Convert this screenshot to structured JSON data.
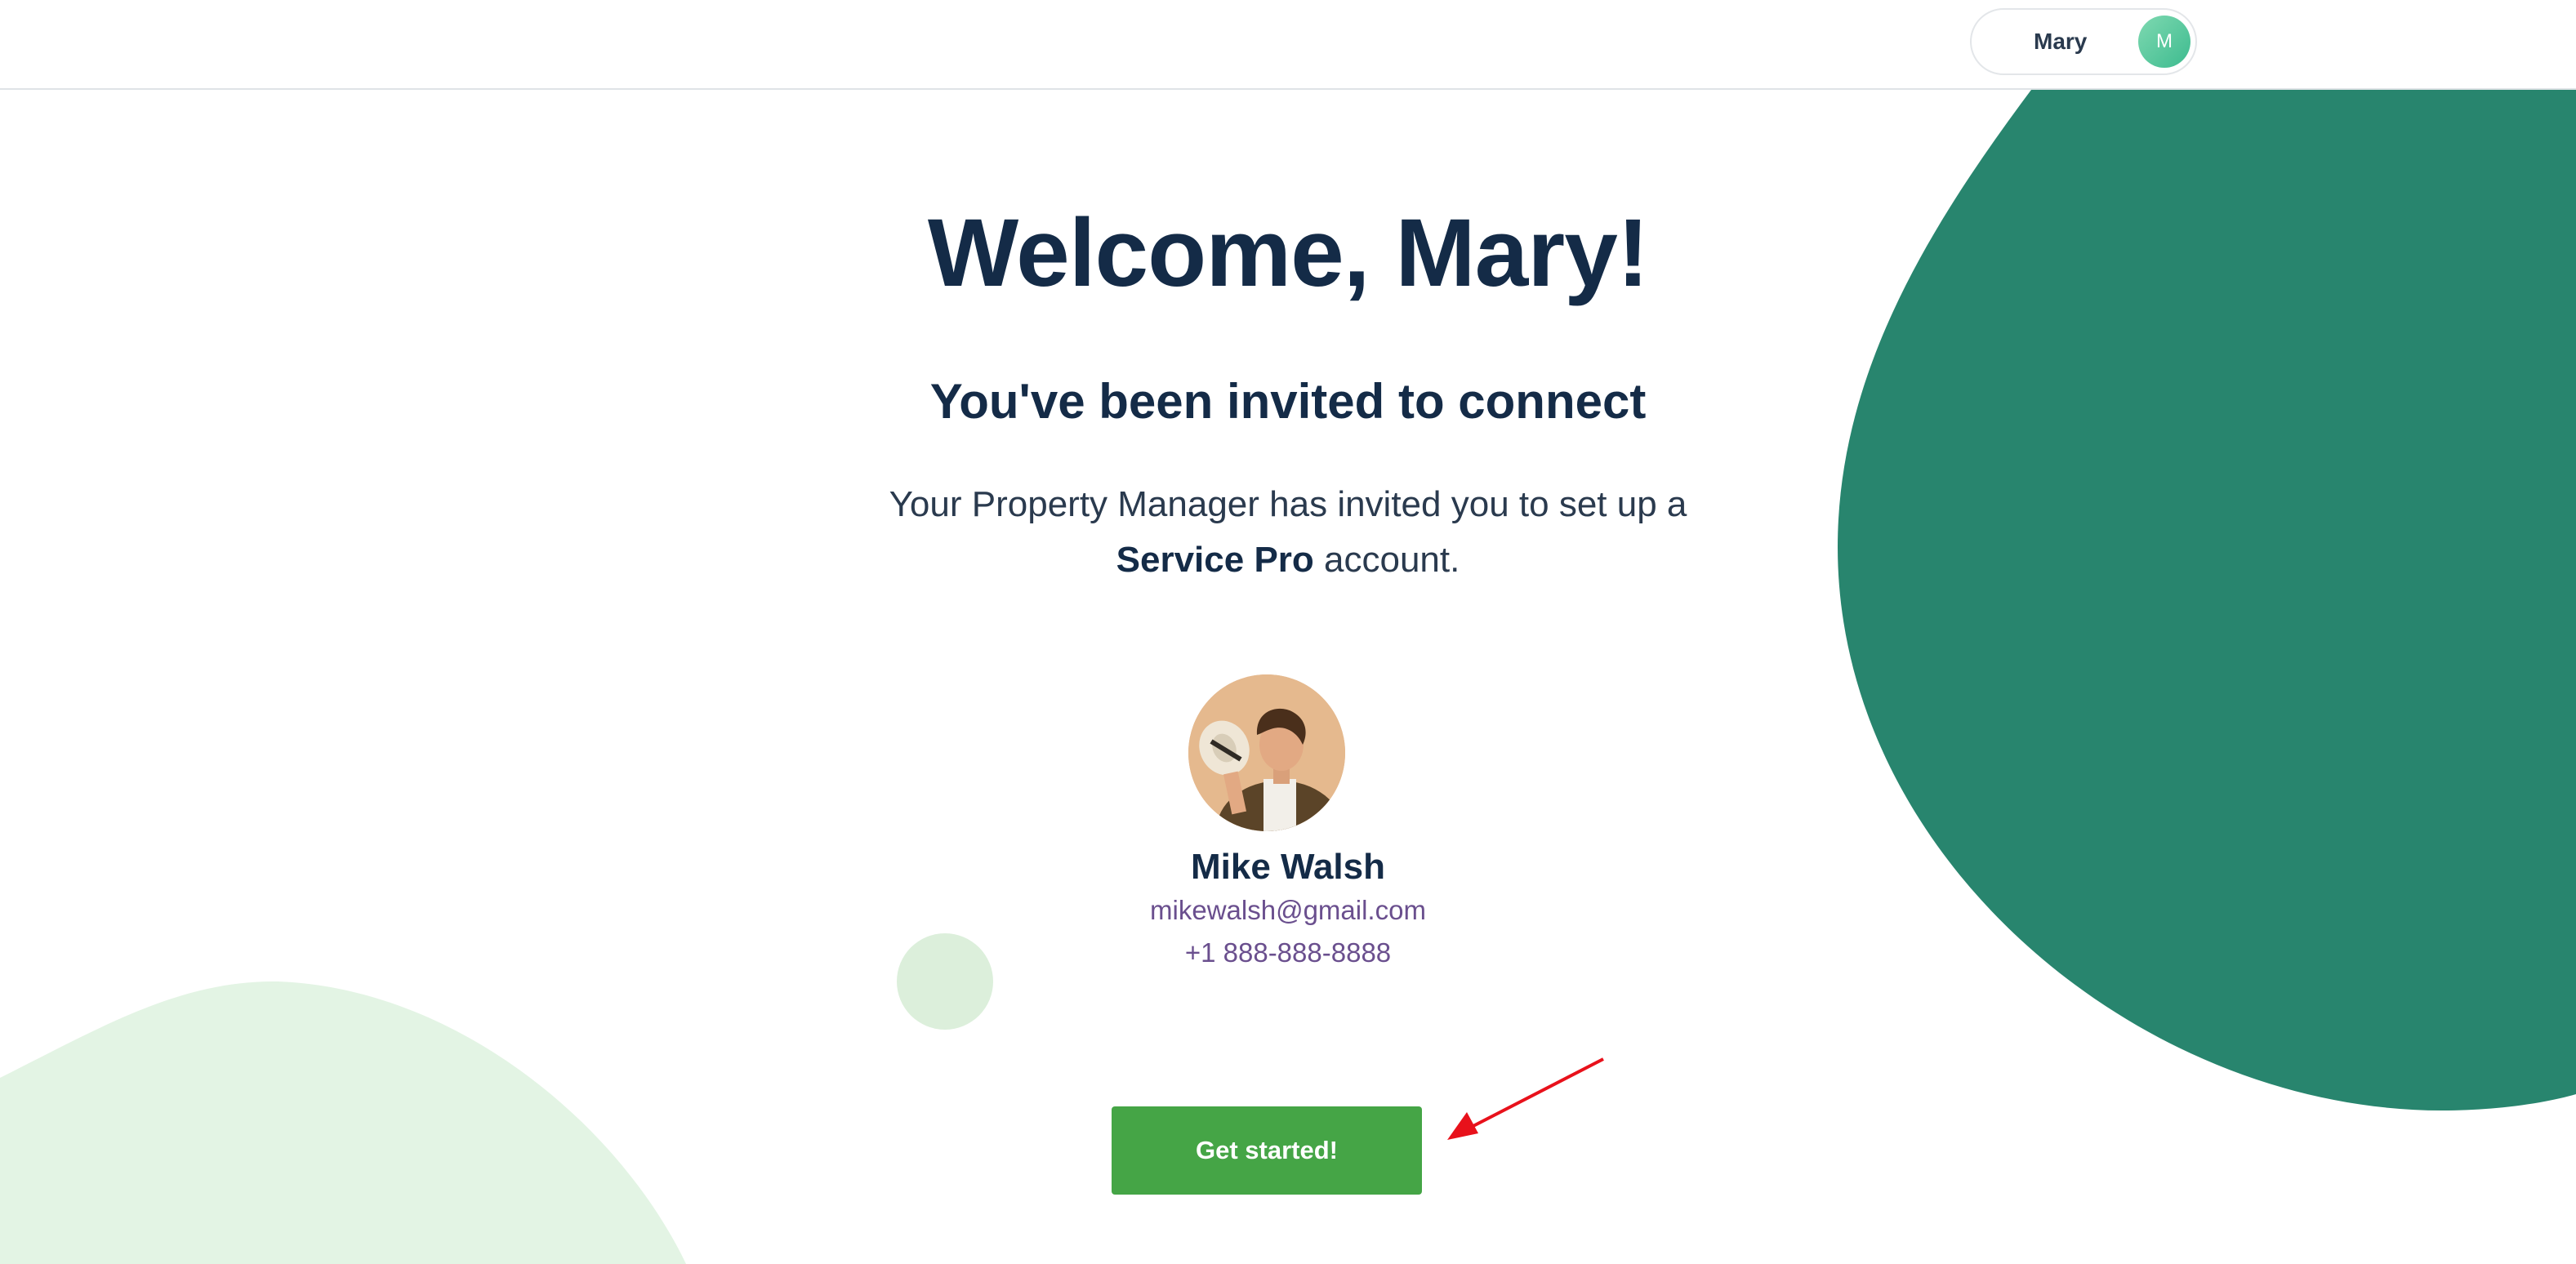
{
  "header": {
    "user_name": "Mary",
    "avatar_initial": "M"
  },
  "welcome": {
    "title": "Welcome, Mary!",
    "subtitle": "You've been invited to connect",
    "description_line1": "Your Property Manager has invited you to set up a",
    "description_bold": "Service Pro",
    "description_tail": " account."
  },
  "contact": {
    "name": "Mike Walsh",
    "email": "mikewalsh@gmail.com",
    "phone": "+1 888-888-8888"
  },
  "cta": {
    "label": "Get started!"
  },
  "colors": {
    "brand_dark_green": "#28856e",
    "light_green": "#e3f4e4",
    "button_green": "#45a546",
    "heading_navy": "#142b47",
    "contact_purple": "#6a4f8e",
    "annotation_red": "#e8111b"
  }
}
